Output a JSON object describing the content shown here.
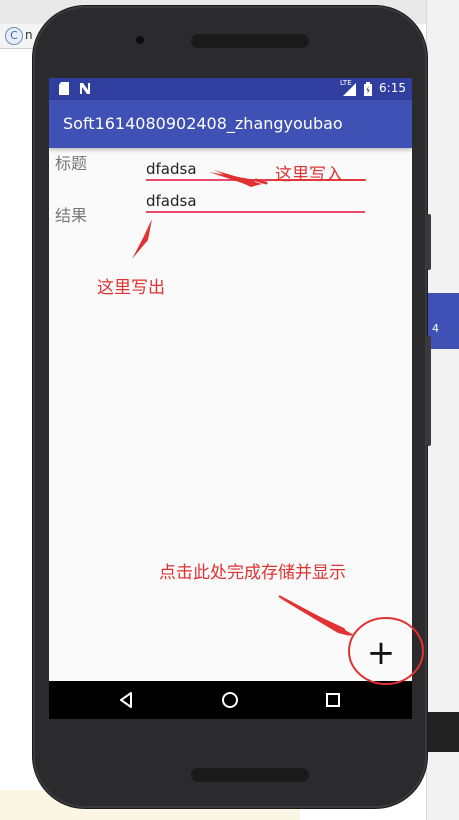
{
  "background": {
    "tab_icon_letter": "C",
    "tab_label": "n",
    "right_panel_text": "4"
  },
  "status_bar": {
    "time": "6:15",
    "network_label": "LTE",
    "icons": [
      "sim-card-icon",
      "notification-n-icon",
      "signal-icon",
      "battery-icon"
    ]
  },
  "app": {
    "title": "Soft1614080902408_zhangyoubao"
  },
  "form": {
    "title_label": "标题",
    "title_value": "dfadsa",
    "result_label": "结果",
    "result_value": "dfadsa"
  },
  "annotations": {
    "write_in": "这里写入",
    "write_out": "这里写出",
    "click_here": "点击此处完成存储并显示"
  },
  "fab": {
    "icon": "plus-icon",
    "glyph": "+"
  },
  "nav": {
    "icons": [
      "back-icon",
      "home-icon",
      "recents-icon"
    ]
  },
  "colors": {
    "primary": "#3f51b5",
    "primary_dark": "#303f9f",
    "accent": "#e8486d",
    "annotation_red": "#e03232"
  }
}
